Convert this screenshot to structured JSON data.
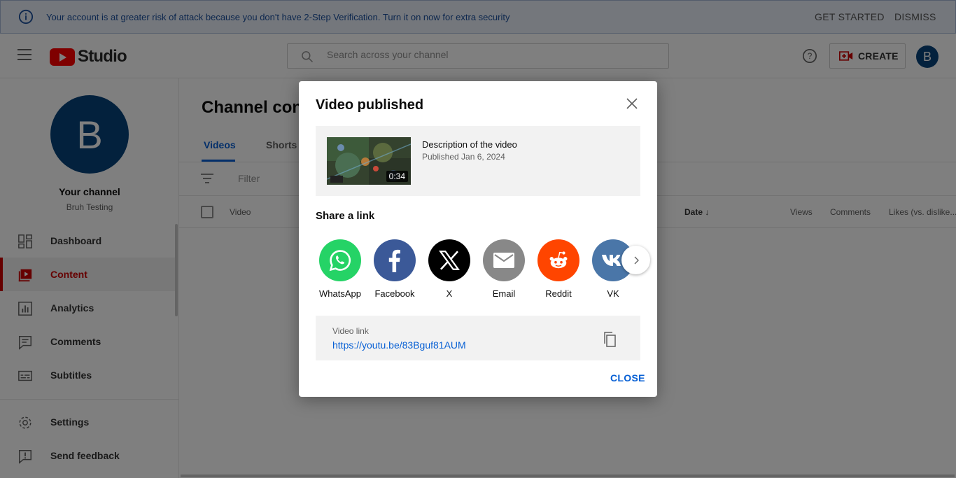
{
  "banner": {
    "message": "Your account is at greater risk of attack because you don't have 2-Step Verification. Turn it on now for extra security",
    "get_started": "GET STARTED",
    "dismiss": "DISMISS"
  },
  "header": {
    "logo_text": "Studio",
    "search_placeholder": "Search across your channel",
    "create_label": "CREATE",
    "avatar_letter": "B"
  },
  "sidebar": {
    "avatar_letter": "B",
    "your_channel": "Your channel",
    "channel_name": "Bruh Testing",
    "items": [
      {
        "label": "Dashboard",
        "icon": "dashboard-icon"
      },
      {
        "label": "Content",
        "icon": "content-icon",
        "active": true
      },
      {
        "label": "Analytics",
        "icon": "analytics-icon"
      },
      {
        "label": "Comments",
        "icon": "comments-icon"
      },
      {
        "label": "Subtitles",
        "icon": "subtitles-icon"
      },
      {
        "label": "Settings",
        "icon": "settings-icon"
      },
      {
        "label": "Send feedback",
        "icon": "feedback-icon"
      }
    ]
  },
  "main": {
    "title": "Channel content",
    "tabs": [
      {
        "label": "Videos",
        "active": true
      },
      {
        "label": "Shorts"
      }
    ],
    "filter_placeholder": "Filter",
    "columns": {
      "video": "Video",
      "date": "Date",
      "views": "Views",
      "comments": "Comments",
      "likes": "Likes (vs. dislike..."
    }
  },
  "dialog": {
    "title": "Video published",
    "video": {
      "description": "Description of the video",
      "published": "Published Jan 6, 2024",
      "duration": "0:34"
    },
    "share_title": "Share a link",
    "share_targets": [
      {
        "name": "WhatsApp",
        "color": "#25d366",
        "icon": "whatsapp-icon"
      },
      {
        "name": "Facebook",
        "color": "#3b5998",
        "icon": "facebook-icon"
      },
      {
        "name": "X",
        "color": "#000000",
        "icon": "x-icon"
      },
      {
        "name": "Email",
        "color": "#888888",
        "icon": "email-icon"
      },
      {
        "name": "Reddit",
        "color": "#ff4500",
        "icon": "reddit-icon"
      },
      {
        "name": "VK",
        "color": "#4a76a8",
        "icon": "vk-icon"
      }
    ],
    "link_label": "Video link",
    "link_url": "https://youtu.be/83Bguf81AUM",
    "close_label": "CLOSE"
  },
  "colors": {
    "accent_blue": "#065fd4",
    "youtube_red": "#ff0000",
    "active_red": "#cc0000",
    "avatar_blue": "#06427a"
  }
}
